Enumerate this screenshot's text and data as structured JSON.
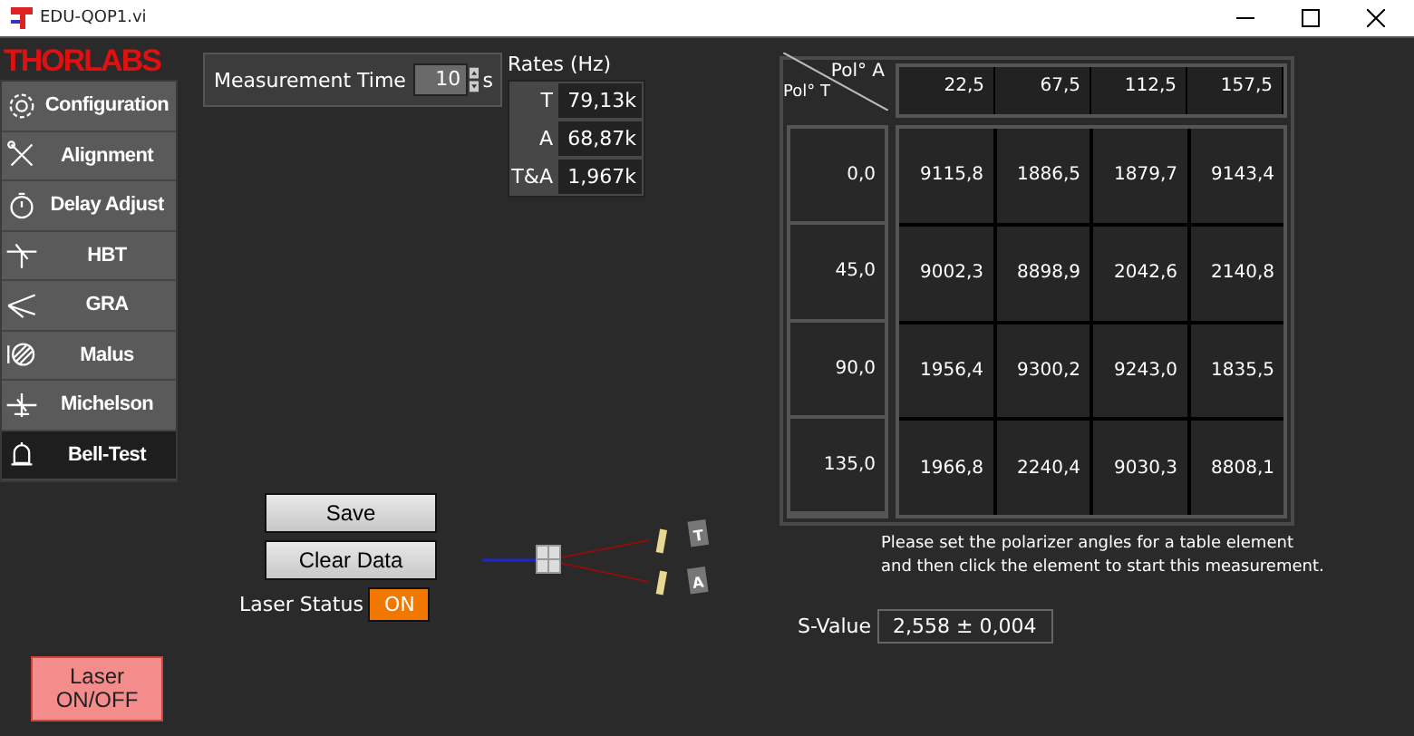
{
  "window": {
    "title": "EDU-QOP1.vi"
  },
  "logo": "THORLABS",
  "sidebar": {
    "items": [
      {
        "label": "Configuration",
        "selected": false
      },
      {
        "label": "Alignment",
        "selected": false
      },
      {
        "label": "Delay Adjust",
        "selected": false
      },
      {
        "label": "HBT",
        "selected": false
      },
      {
        "label": "GRA",
        "selected": false
      },
      {
        "label": "Malus",
        "selected": false
      },
      {
        "label": "Michelson",
        "selected": false
      },
      {
        "label": "Bell-Test",
        "selected": true
      }
    ]
  },
  "measurement_time": {
    "label": "Measurement Time",
    "value": "10",
    "unit": "s"
  },
  "rates": {
    "title": "Rates (Hz)",
    "rows": [
      {
        "label": "T",
        "value": "79,13k"
      },
      {
        "label": "A",
        "value": "68,87k"
      },
      {
        "label": "T&A",
        "value": "1,967k"
      }
    ]
  },
  "buttons": [
    "Save",
    "Clear Data"
  ],
  "laser_status": {
    "label": "Laser Status",
    "text": "ON",
    "on": true
  },
  "laser_button": "Laser\nON/OFF",
  "diagram": {
    "detectors": [
      "T",
      "A"
    ]
  },
  "table": {
    "col_axis": "Pol° A",
    "row_axis": "Pol° T",
    "columns": [
      "22,5",
      "67,5",
      "112,5",
      "157,5"
    ],
    "rows": [
      {
        "label": "0,0",
        "cells": [
          "9115,8",
          "1886,5",
          "1879,7",
          "9143,4"
        ]
      },
      {
        "label": "45,0",
        "cells": [
          "9002,3",
          "8898,9",
          "2042,6",
          "2140,8"
        ]
      },
      {
        "label": "90,0",
        "cells": [
          "1956,4",
          "9300,2",
          "9243,0",
          "1835,5"
        ]
      },
      {
        "label": "135,0",
        "cells": [
          "1966,8",
          "2240,4",
          "9030,3",
          "8808,1"
        ]
      }
    ]
  },
  "note": "Please set the polarizer angles for a table element\nand then click the element to start this measurement.",
  "s_value": {
    "label": "S-Value",
    "value": "2,558 ± 0,004"
  }
}
